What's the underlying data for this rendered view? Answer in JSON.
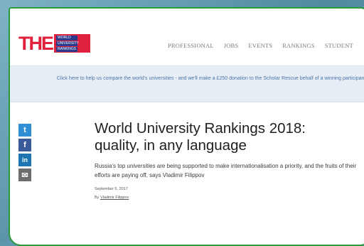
{
  "logo": {
    "mark": "THE",
    "lines": [
      "WORLD",
      "UNIVERSITY",
      "RANKINGS"
    ]
  },
  "nav": {
    "items": [
      "PROFESSIONAL",
      "JOBS",
      "EVENTS",
      "RANKINGS",
      "STUDENT"
    ]
  },
  "banner": {
    "text": "Click here to help us compare the world's universities - and we'll make a £250 donation to the Scholar Rescue behalf of a winning participant."
  },
  "social": {
    "twitter": "t",
    "facebook": "f",
    "linkedin": "in",
    "email": "✉"
  },
  "article": {
    "title_line1": "World University Rankings 2018:",
    "title_line2": "quality, in any language",
    "standfirst": "Russia's top universities are being supported to make internationalisation a priority, and the fruits of their efforts are paying off, says Vladimir Filippov",
    "date": "September 5, 2017",
    "byline_prefix": "By",
    "author": "Vladimir Filippov"
  },
  "colors": {
    "brand_red": "#e0213d",
    "frame_border": "#2a9a3a",
    "banner_bg": "#e8eef6",
    "link_blue": "#4a74a6"
  }
}
